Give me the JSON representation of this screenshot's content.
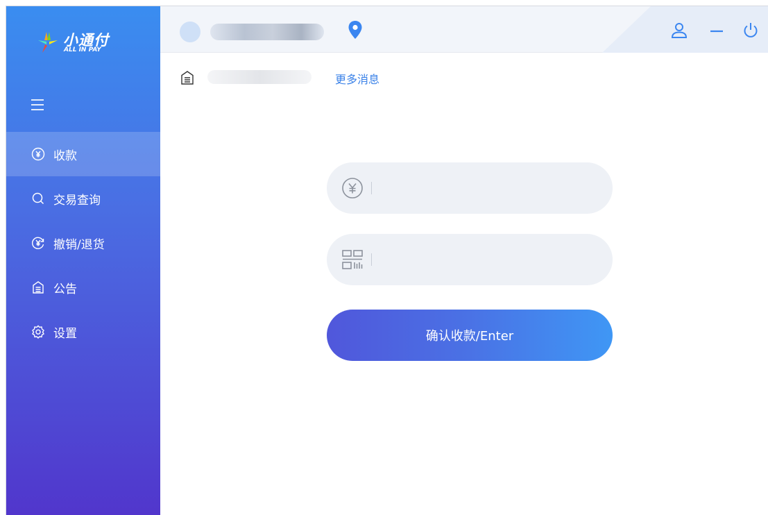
{
  "app": {
    "logo_cn": "小通付",
    "logo_en": "ALL IN PAY"
  },
  "sidebar": {
    "items": [
      {
        "label": "收款",
        "icon": "yen-circle-icon",
        "active": true
      },
      {
        "label": "交易查询",
        "icon": "search-icon",
        "active": false
      },
      {
        "label": "撤销/退货",
        "icon": "yen-return-icon",
        "active": false
      },
      {
        "label": "公告",
        "icon": "notice-icon",
        "active": false
      },
      {
        "label": "设置",
        "icon": "gear-icon",
        "active": false
      }
    ]
  },
  "header": {
    "icons": [
      "location-icon",
      "user-icon",
      "minimize-icon",
      "power-icon"
    ]
  },
  "notice": {
    "more_label": "更多消息"
  },
  "form": {
    "amount_icon": "yen-icon",
    "code_icon": "qrcode-icon",
    "amount_value": "",
    "code_value": "",
    "confirm_label": "确认收款/Enter"
  },
  "colors": {
    "sidebar_top": "#3a8df0",
    "sidebar_bottom": "#5136cc",
    "accent": "#3b82e8",
    "button_left": "#5057db",
    "button_right": "#3f97f5"
  }
}
